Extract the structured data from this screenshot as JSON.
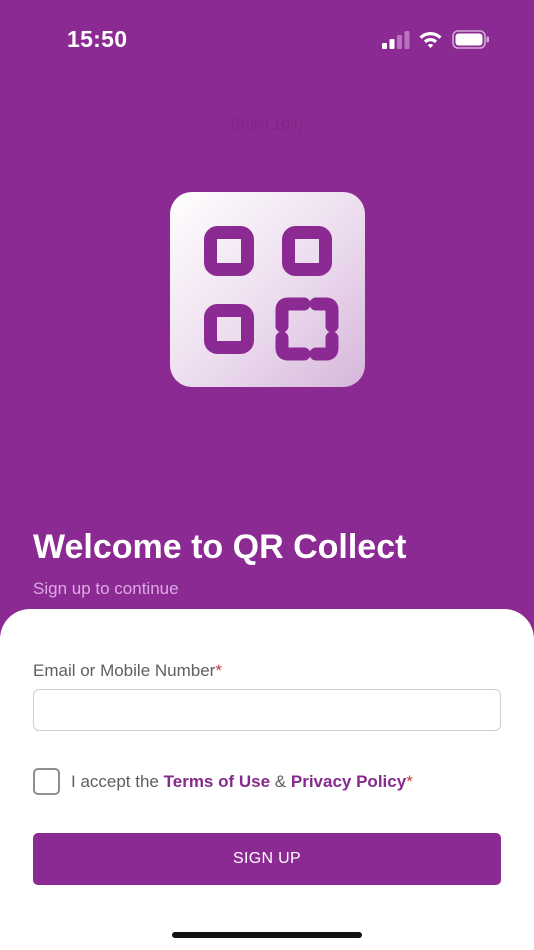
{
  "status_bar": {
    "time": "15:50"
  },
  "build_label": "(Build 104)",
  "logo": {
    "icon": "qr-code-scan-icon",
    "accent": "#8c2a93"
  },
  "welcome": {
    "title": "Welcome to QR Collect",
    "subtitle": "Sign up to continue"
  },
  "form": {
    "email_label": "Email or Mobile Number",
    "email_value": "",
    "required_marker": "*",
    "terms": {
      "prefix": "I accept the ",
      "terms_link": "Terms of Use",
      "conjunction": " & ",
      "privacy_link": "Privacy Policy",
      "required_marker": "*",
      "checked": false
    },
    "submit_label": "SIGN UP"
  },
  "colors": {
    "brand_purple": "#8c2a93",
    "link_purple": "#862a8e",
    "required_red": "#c23b3b"
  }
}
